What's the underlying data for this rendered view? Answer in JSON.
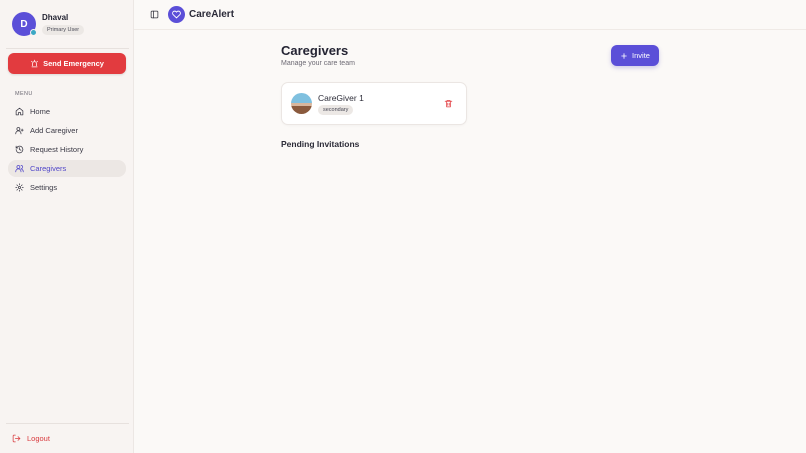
{
  "sidebar": {
    "user": {
      "initial": "D",
      "name": "Dhaval",
      "role": "Primary User"
    },
    "emergency_label": "Send Emergency",
    "menu_label": "MENU",
    "items": [
      {
        "label": "Home",
        "icon": "home-icon",
        "active": false
      },
      {
        "label": "Add Caregiver",
        "icon": "user-plus-icon",
        "active": false
      },
      {
        "label": "Request History",
        "icon": "history-icon",
        "active": false
      },
      {
        "label": "Caregivers",
        "icon": "users-icon",
        "active": true
      },
      {
        "label": "Settings",
        "icon": "gear-icon",
        "active": false
      }
    ],
    "logout_label": "Logout"
  },
  "header": {
    "app_name": "CareAlert"
  },
  "main": {
    "title": "Caregivers",
    "subtitle": "Manage your care team",
    "invite_label": "Invite",
    "caregivers": [
      {
        "name": "CareGiver 1",
        "role": "secondary"
      }
    ],
    "pending_title": "Pending Invitations"
  },
  "colors": {
    "accent": "#5b4fd8",
    "danger": "#e23b3f",
    "status": "#3ba8c4"
  }
}
